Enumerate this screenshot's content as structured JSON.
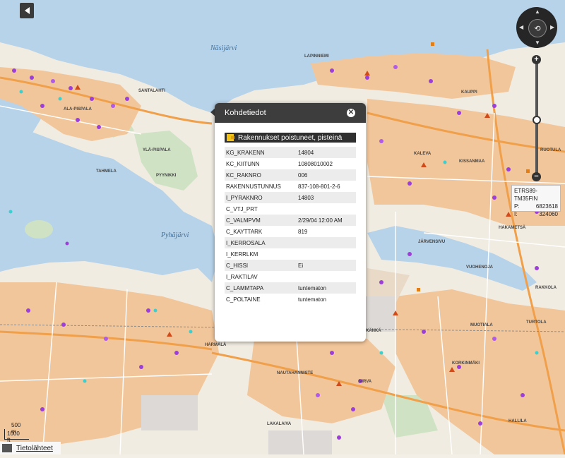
{
  "map": {
    "lakes": {
      "nasijarvi": "Näsijärvi",
      "pyhajarvi": "Pyhäjärvi"
    },
    "places": [
      "SANTALAHTI",
      "ALA-PISPALA",
      "TAHMELA",
      "YLÄ-PISPALA",
      "PYYNIKKI",
      "LAPINNIEMI",
      "KAUPPI",
      "KALEVA",
      "KISSANMAA",
      "HAKAMETSÄ",
      "JÄRVENSIVU",
      "VUOHENOJA",
      "RUOTULA",
      "TURTOLA",
      "MUOTIALA",
      "RAKKOLA",
      "KORKINMÄKI",
      "NIRVA",
      "LAKALAIVA",
      "HALLILA",
      "HÄRMÄLÄ",
      "NAUTAHANNISTE",
      "KÄNKÄ"
    ]
  },
  "coords": {
    "system": "ETRS89-TM35FIN",
    "p_label": "P:",
    "p_value": "6823618",
    "i_label": "I:",
    "i_value": "324060"
  },
  "zoom": {
    "plus": "+",
    "minus": "−",
    "level": 0.55
  },
  "popup": {
    "title": "Kohdetiedot",
    "layer_title": "Rakennukset poistuneet, pisteinä",
    "fields": [
      {
        "key": "KG_KRAKENN",
        "value": "14804"
      },
      {
        "key": "KC_KIITUNN",
        "value": "10808010002"
      },
      {
        "key": "KC_RAKNRO",
        "value": "006"
      },
      {
        "key": "RAKENNUSTUNNUS",
        "value": "837-108-801-2-6"
      },
      {
        "key": "I_PYRAKNRO",
        "value": "14803"
      },
      {
        "key": "C_VTJ_PRT",
        "value": ""
      },
      {
        "key": "C_VALMPVM",
        "value": "2/29/04 12:00 AM"
      },
      {
        "key": "C_KAYTTARK",
        "value": "819"
      },
      {
        "key": "I_KERROSALA",
        "value": ""
      },
      {
        "key": "I_KERRLKM",
        "value": ""
      },
      {
        "key": "C_HISSI",
        "value": "Ei"
      },
      {
        "key": "I_RAKTILAV",
        "value": ""
      },
      {
        "key": "C_LAMMTAPA",
        "value": "tuntematon"
      },
      {
        "key": "C_POLTAINE",
        "value": "tuntematon"
      }
    ]
  },
  "scale": {
    "m": "500 m",
    "ft": "1000 ft"
  },
  "footer": {
    "sources": "Tietolähteet"
  }
}
